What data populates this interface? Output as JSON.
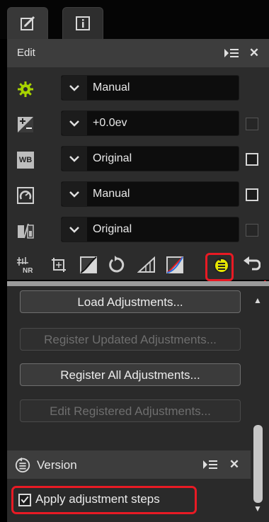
{
  "tabs": [
    {
      "name": "edit-tab",
      "icon": "pencil-icon",
      "active": true
    },
    {
      "name": "info-tab",
      "icon": "info-icon",
      "active": false
    }
  ],
  "edit_panel": {
    "title": "Edit",
    "rows": [
      {
        "icon": "picture-control-gear-icon",
        "value": "Manual",
        "checkbox": "none"
      },
      {
        "icon": "exposure-compensation-icon",
        "value": "+0.0ev",
        "checkbox": "disabled"
      },
      {
        "icon": "white-balance-icon",
        "icon_text": "WB",
        "value": "Original",
        "checkbox": "enabled"
      },
      {
        "icon": "picture-control-icon",
        "value": "Manual",
        "checkbox": "enabled"
      },
      {
        "icon": "active-d-lighting-icon",
        "value": "Original",
        "checkbox": "disabled"
      }
    ],
    "toolbar": [
      {
        "icon": "noise-reduction-icon",
        "icon_text": "NR"
      },
      {
        "icon": "crop-icon"
      },
      {
        "icon": "levels-icon"
      },
      {
        "icon": "rotate-icon"
      },
      {
        "icon": "straighten-icon"
      },
      {
        "icon": "color-balance-icon"
      },
      {
        "icon": "adjustment-steps-icon",
        "highlighted": true
      },
      {
        "icon": "undo-icon"
      }
    ]
  },
  "adjustments": {
    "buttons": [
      {
        "label": "Load Adjustments...",
        "enabled": true
      },
      {
        "label": "Register Updated Adjustments...",
        "enabled": false
      },
      {
        "label": "Register All Adjustments...",
        "enabled": true
      },
      {
        "label": "Edit Registered Adjustments...",
        "enabled": false
      }
    ]
  },
  "version_panel": {
    "title": "Version",
    "apply_checkbox": {
      "label": "Apply adjustment steps",
      "checked": true
    }
  },
  "colors": {
    "highlight": "#e81a24",
    "gear_green": "#a8d400",
    "steps_icon_yellow": "#e6e600"
  }
}
